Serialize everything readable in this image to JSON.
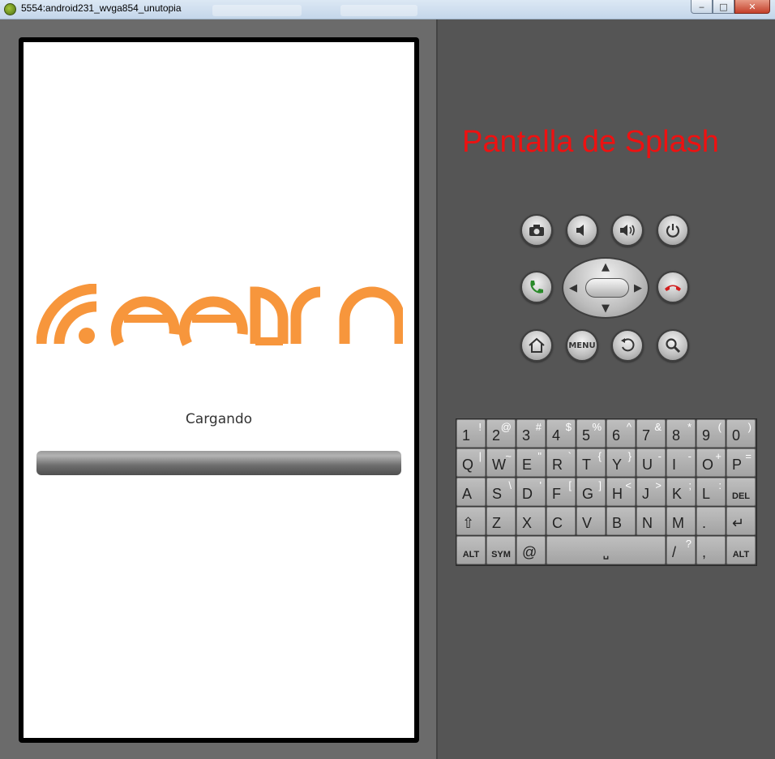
{
  "window": {
    "title": "5554:android231_wvga854_unutopia",
    "minimize_label": "‒",
    "maximize_label": "□",
    "close_label": "✕"
  },
  "screen": {
    "logo_text": "feedrn",
    "loading_label": "Cargando",
    "progress_value": 0
  },
  "skin": {
    "title": "Pantalla de Splash",
    "title_color": "#ee1111"
  },
  "controls": {
    "menu_label": "MENU"
  },
  "keyboard": {
    "rows": [
      [
        {
          "main": "1",
          "alt": "!"
        },
        {
          "main": "2",
          "alt": "@"
        },
        {
          "main": "3",
          "alt": "#"
        },
        {
          "main": "4",
          "alt": "$"
        },
        {
          "main": "5",
          "alt": "%"
        },
        {
          "main": "6",
          "alt": "^"
        },
        {
          "main": "7",
          "alt": "&"
        },
        {
          "main": "8",
          "alt": "*"
        },
        {
          "main": "9",
          "alt": "("
        },
        {
          "main": "0",
          "alt": ")"
        }
      ],
      [
        {
          "main": "Q",
          "alt": "|"
        },
        {
          "main": "W",
          "alt": "~"
        },
        {
          "main": "E",
          "alt": "\""
        },
        {
          "main": "R",
          "alt": "`"
        },
        {
          "main": "T",
          "alt": "{"
        },
        {
          "main": "Y",
          "alt": "}"
        },
        {
          "main": "U",
          "alt": "-"
        },
        {
          "main": "I",
          "alt": "-"
        },
        {
          "main": "O",
          "alt": "+"
        },
        {
          "main": "P",
          "alt": "="
        }
      ],
      [
        {
          "main": "A",
          "alt": ""
        },
        {
          "main": "S",
          "alt": "\\"
        },
        {
          "main": "D",
          "alt": "'"
        },
        {
          "main": "F",
          "alt": "["
        },
        {
          "main": "G",
          "alt": "]"
        },
        {
          "main": "H",
          "alt": "<"
        },
        {
          "main": "J",
          "alt": ">"
        },
        {
          "main": "K",
          "alt": ";"
        },
        {
          "main": "L",
          "alt": ":"
        },
        {
          "main": "DEL",
          "alt": ""
        }
      ],
      [
        {
          "main": "⇧",
          "alt": ""
        },
        {
          "main": "Z",
          "alt": ""
        },
        {
          "main": "X",
          "alt": ""
        },
        {
          "main": "C",
          "alt": ""
        },
        {
          "main": "V",
          "alt": ""
        },
        {
          "main": "B",
          "alt": ""
        },
        {
          "main": "N",
          "alt": ""
        },
        {
          "main": "M",
          "alt": ""
        },
        {
          "main": ".",
          "alt": ""
        },
        {
          "main": "↵",
          "alt": ""
        }
      ]
    ],
    "bottom_row": {
      "alt_left": "ALT",
      "sym": "SYM",
      "at": "@",
      "space": "␣",
      "slash": "/",
      "slash_alt": "?",
      "comma": ",",
      "alt_right": "ALT"
    }
  },
  "icons": {
    "camera": "camera-icon",
    "volume_down": "volume-down-icon",
    "volume_up": "volume-up-icon",
    "power": "power-icon",
    "call": "call-icon",
    "end_call": "end-call-icon",
    "home": "home-icon",
    "back": "back-icon",
    "search": "search-icon"
  },
  "colors": {
    "logo_orange": "#f7963c",
    "call_green": "#2a8a2a",
    "end_call_red": "#d21f1f"
  }
}
